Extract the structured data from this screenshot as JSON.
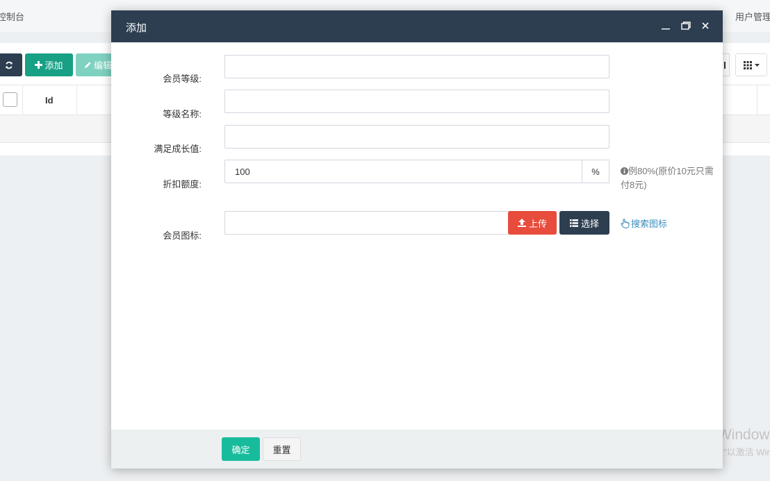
{
  "background": {
    "topbar_left": "控制台",
    "topbar_right": "用户管理",
    "toolbar": {
      "add_label": "添加",
      "edit_label": "编辑"
    },
    "table": {
      "col_id": "Id"
    }
  },
  "modal": {
    "title": "添加",
    "fields": {
      "level": {
        "label": "会员等级:",
        "value": ""
      },
      "name": {
        "label": "等级名称:",
        "value": ""
      },
      "growth": {
        "label": "满足成长值:",
        "value": ""
      },
      "discount": {
        "label": "折扣额度:",
        "value": "100",
        "addon": "%",
        "help": "例80%(原价10元只需付8元)"
      },
      "icon": {
        "label": "会员图标:",
        "value": "",
        "upload_label": "上传",
        "select_label": "选择",
        "search_label": "搜索图标"
      }
    },
    "footer": {
      "ok_label": "确定",
      "reset_label": "重置"
    }
  },
  "watermark": {
    "line1": "激活 Windows",
    "line2": "转到“设置”以激活 Windows。"
  },
  "colors": {
    "header": "#2c3e50",
    "success": "#18bc9c",
    "danger": "#e74c3c",
    "primary_dark": "#2c3e50",
    "link": "#3c8dbc"
  }
}
